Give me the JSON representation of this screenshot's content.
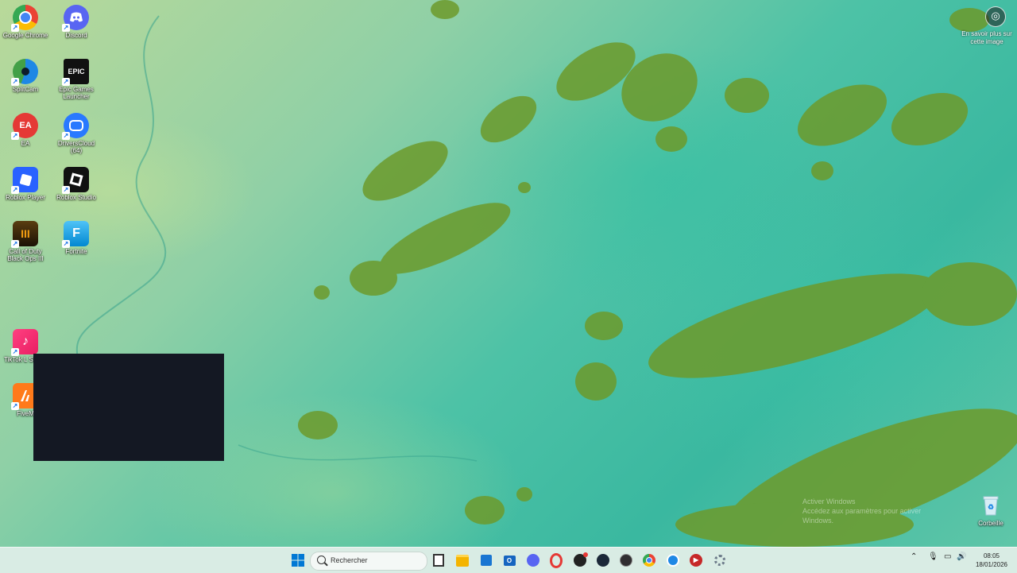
{
  "desktop": {
    "icons": [
      {
        "label": "Google Chrome",
        "icon": "chrome-icon",
        "color": "#ffffff"
      },
      {
        "label": "Discord",
        "icon": "discord-icon",
        "color": "#5865f2"
      },
      {
        "label": "SplitCam",
        "icon": "splitcam-icon",
        "color": "#1e88e5"
      },
      {
        "label": "Epic Games Launcher",
        "icon": "epic-games-icon",
        "color": "#111111",
        "glyph": "EPIC"
      },
      {
        "label": "EA",
        "icon": "ea-icon",
        "color": "#e53935",
        "glyph": "EA"
      },
      {
        "label": "DriversCloud (64)",
        "icon": "driverscloud-icon",
        "color": "#2979ff"
      },
      {
        "label": "Roblox Player",
        "icon": "roblox-player-icon",
        "color": "#2962ff"
      },
      {
        "label": "Roblox Studio",
        "icon": "roblox-studio-icon",
        "color": "#111111"
      },
      {
        "label": "Call of Duty Black Ops III",
        "icon": "call-of-duty-icon",
        "color": "#3a2a10",
        "glyph": "III"
      },
      {
        "label": "Fortnite",
        "icon": "fortnite-icon",
        "color": "#29b6f6",
        "glyph": "F"
      },
      {
        "label": "TikTok L Studio",
        "icon": "tiktok-studio-icon",
        "color": "#e91e63"
      },
      {
        "label": "FiveM",
        "icon": "fivem-icon",
        "color": "#ff7a1a"
      },
      {
        "label": "Corbeille",
        "icon": "recycle-bin-icon",
        "color": "#d7eef6"
      }
    ],
    "image_info": {
      "text": "En savoir plus sur cette image",
      "icon": "camera-info-icon"
    },
    "watermark": "Activer Windows\nAccédez aux paramètres pour activer Windows."
  },
  "taskbar": {
    "search_placeholder": "Rechercher",
    "apps": [
      {
        "name": "task-view-icon",
        "color": "#333333"
      },
      {
        "name": "file-explorer-icon",
        "color": "#f4b400"
      },
      {
        "name": "microsoft-store-icon",
        "color": "#1976d2"
      },
      {
        "name": "outlook-icon",
        "color": "#1565c0"
      },
      {
        "name": "discord-icon",
        "color": "#5865f2"
      },
      {
        "name": "opera-icon",
        "color": "#e53935"
      },
      {
        "name": "app-red-dot-icon",
        "color": "#222222"
      },
      {
        "name": "steam-icon",
        "color": "#1b2838"
      },
      {
        "name": "obs-icon",
        "color": "#302e31"
      },
      {
        "name": "chrome-icon",
        "color": "#ffffff"
      },
      {
        "name": "splitcam-icon",
        "color": "#1e88e5"
      },
      {
        "name": "media-player-icon",
        "color": "#c62828"
      },
      {
        "name": "settings-icon",
        "color": "#6c7a89"
      }
    ],
    "tray": {
      "time": "08:05",
      "date": "18/01/2026"
    },
    "colors": {
      "start": "#0078d4"
    }
  }
}
